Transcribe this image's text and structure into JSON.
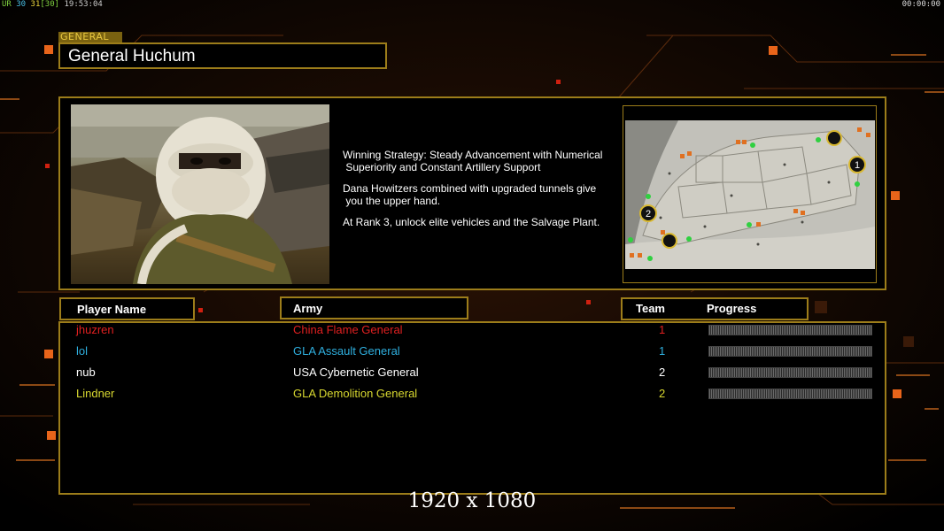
{
  "hud": {
    "fps_label": "UR",
    "fps_a": "30",
    "fps_b": "31",
    "fps_c": "[30]",
    "time": "19:53:04",
    "clock": "00:00:00"
  },
  "general": {
    "tag": "GENERAL",
    "name": "General Huchum",
    "strategy": [
      "Winning Strategy: Steady Advancement with Numerical\n Superiority and Constant Artillery Support",
      "Dana Howitzers combined with upgraded tunnels give\n you the upper hand.",
      "At Rank 3, unlock elite vehicles and the Salvage Plant."
    ]
  },
  "map": {
    "markers": [
      "1",
      "2"
    ]
  },
  "table": {
    "headers": {
      "player": "Player Name",
      "army": "Army",
      "team": "Team",
      "progress": "Progress"
    },
    "rows": [
      {
        "player": "jhuzren",
        "army": "China Flame General",
        "team": "1",
        "color": "#e02020",
        "progress": 0
      },
      {
        "player": "lol",
        "army": "GLA Assault General",
        "team": "1",
        "color": "#2fb0e0",
        "progress": 0
      },
      {
        "player": "nub",
        "army": "USA Cybernetic General",
        "team": "2",
        "color": "#ffffff",
        "progress": 0
      },
      {
        "player": "Lindner",
        "army": "GLA Demolition General",
        "team": "2",
        "color": "#d8d830",
        "progress": 0
      }
    ]
  },
  "overlay": {
    "resolution": "1920 x 1080"
  }
}
